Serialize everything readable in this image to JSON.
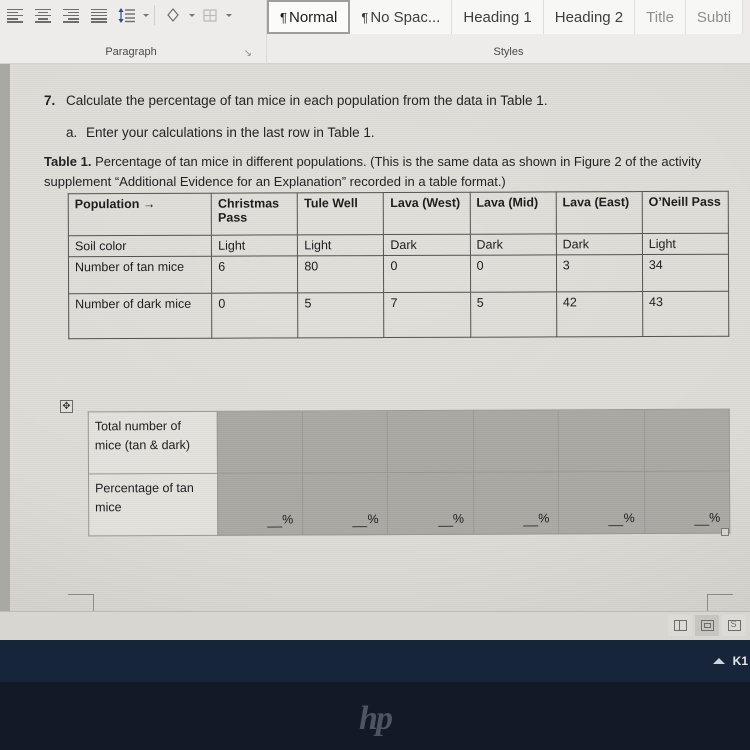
{
  "ribbon": {
    "paragraph_group": {
      "label": "Paragraph",
      "dialog_launcher": "↘",
      "buttons": [
        {
          "name": "align-left-icon",
          "label": "Align Left"
        },
        {
          "name": "align-center-icon",
          "label": "Center"
        },
        {
          "name": "align-right-icon",
          "label": "Align Right"
        },
        {
          "name": "justify-icon",
          "label": "Justify"
        },
        {
          "name": "line-spacing-icon",
          "label": "Line and Paragraph Spacing"
        },
        {
          "name": "shading-icon",
          "label": "Shading"
        },
        {
          "name": "borders-icon",
          "label": "Borders"
        }
      ]
    },
    "styles_group": {
      "label": "Styles",
      "items": [
        {
          "pilcrow": "¶",
          "label": "Normal",
          "selected": true
        },
        {
          "pilcrow": "¶",
          "label": "No Spac...",
          "selected": false
        },
        {
          "pilcrow": "",
          "label": "Heading 1",
          "selected": false
        },
        {
          "pilcrow": "",
          "label": "Heading 2",
          "selected": false
        },
        {
          "pilcrow": "",
          "label": "Title",
          "selected": false
        },
        {
          "pilcrow": "",
          "label": "Subti",
          "selected": false
        }
      ]
    }
  },
  "document": {
    "question_number": "7.",
    "question_text": "Calculate the percentage of tan mice in each population from the data in Table 1.",
    "sub_letter": "a.",
    "sub_text": "Enter your calculations in the last row in Table 1.",
    "caption_bold": "Table 1.",
    "caption_rest": " Percentage of tan mice in different populations. (This is the same data as shown in Figure 2 of the activity supplement “Additional Evidence for an Explanation” recorded in a table format.)",
    "table": {
      "header": [
        "Population →",
        "Christmas Pass",
        "Tule Well",
        "Lava (West)",
        "Lava (Mid)",
        "Lava (East)",
        "O’Neill Pass"
      ],
      "rows": [
        {
          "label": "Soil color",
          "values": [
            "Light",
            "Light",
            "Dark",
            "Dark",
            "Dark",
            "Light"
          ]
        },
        {
          "label": "Number of tan mice",
          "values": [
            "6",
            "80",
            "0",
            "0",
            "3",
            "34"
          ]
        },
        {
          "label": "Number of dark mice",
          "values": [
            "0",
            "5",
            "7",
            "5",
            "42",
            "43"
          ]
        }
      ],
      "selected_rows": [
        {
          "label": "Total number of mice (tan & dark)",
          "values": [
            "",
            "",
            "",
            "",
            "",
            ""
          ]
        },
        {
          "label": "Percentage of tan mice",
          "values": [
            "%",
            "%",
            "%",
            "%",
            "%",
            "%"
          ]
        }
      ]
    },
    "table_move_handle": "✥",
    "selection_color": "#aaa9a3"
  },
  "status_bar": {
    "view_buttons": [
      {
        "name": "read-mode-icon",
        "label": "Read Mode",
        "active": false
      },
      {
        "name": "print-layout-icon",
        "label": "Print Layout",
        "active": true
      },
      {
        "name": "web-layout-icon",
        "label": "Web Layout",
        "active": false
      }
    ]
  },
  "taskbar": {
    "show_hidden_icons": "˄",
    "tray_text": "K1",
    "background": "#16253a"
  },
  "bezel": {
    "logo": "hp"
  }
}
